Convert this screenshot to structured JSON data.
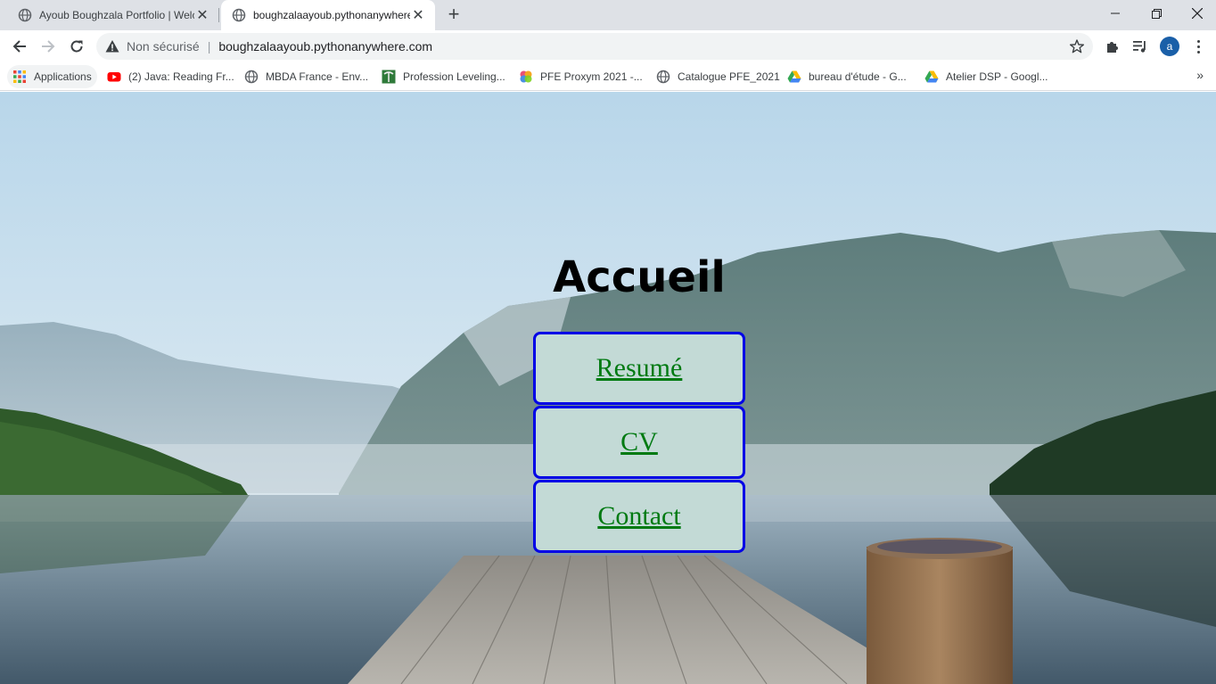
{
  "browser": {
    "tabs": [
      {
        "title": "Ayoub Boughzala Portfolio | Welc",
        "active": false
      },
      {
        "title": "boughzalaayoub.pythonanywhere",
        "active": true
      }
    ],
    "new_tab_label": "+",
    "address_bar": {
      "security_label": "Non sécurisé",
      "separator": "|",
      "url": "boughzalaayoub.pythonanywhere.com"
    },
    "profile_initial": "a",
    "bookmarks": [
      {
        "label": "Applications",
        "icon": "apps-grid-icon"
      },
      {
        "label": "(2) Java: Reading Fr...",
        "icon": "youtube-icon"
      },
      {
        "label": "MBDA France - Env...",
        "icon": "globe-icon"
      },
      {
        "label": "Profession Leveling...",
        "icon": "pickaxe-icon"
      },
      {
        "label": "PFE Proxym 2021 -...",
        "icon": "colorful-flower-icon"
      },
      {
        "label": "Catalogue PFE_2021",
        "icon": "globe-icon"
      },
      {
        "label": "bureau d'étude - G...",
        "icon": "google-drive-icon"
      },
      {
        "label": "Atelier DSP - Googl...",
        "icon": "google-drive-icon"
      }
    ],
    "bookmarks_overflow": "»"
  },
  "page": {
    "heading": "Accueil",
    "links": [
      {
        "label": "Resumé"
      },
      {
        "label": "CV"
      },
      {
        "label": "Contact"
      }
    ],
    "colors": {
      "link_text": "#007a12",
      "link_border": "#0000e6",
      "link_background": "#c3dad6"
    }
  }
}
